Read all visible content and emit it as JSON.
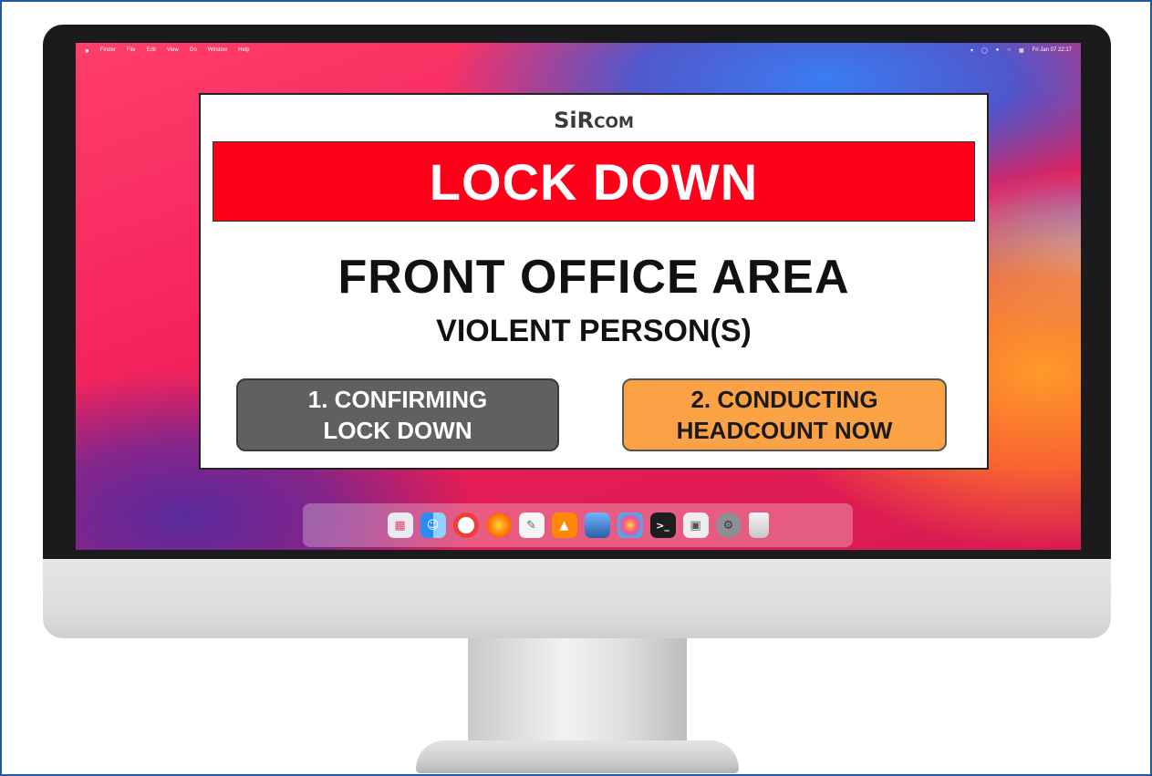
{
  "menubar": {
    "apple_icon": "apple-logo-icon",
    "items": [
      "Finder",
      "File",
      "Edit",
      "View",
      "Go",
      "Window",
      "Help"
    ],
    "status_icons": [
      "wifi-icon",
      "shield-icon",
      "volume-icon",
      "search-icon",
      "control-center-icon"
    ],
    "clock": "Fri Jan 07 22:17"
  },
  "alert": {
    "brand_big": "SiR",
    "brand_small": "COM",
    "banner": "LOCK DOWN",
    "area": "FRONT OFFICE AREA",
    "incident": "VIOLENT PERSON(S)",
    "button1": {
      "line1": "1. CONFIRMING",
      "line2": "LOCK DOWN"
    },
    "button2": {
      "line1": "2. CONDUCTING",
      "line2": "HEADCOUNT NOW"
    }
  },
  "colors": {
    "banner_red": "#ff001a",
    "button1_gray": "#606060",
    "button2_orange": "#fba247",
    "frame_blue": "#1f5a9e"
  },
  "dock": {
    "apps": [
      "launchpad-icon",
      "finder-icon",
      "chrome-icon",
      "firefox-icon",
      "textedit-icon",
      "vlc-icon",
      "preview-icon",
      "photos-icon",
      "terminal-icon",
      "screenshot-icon",
      "system-preferences-icon",
      "trash-icon"
    ]
  }
}
